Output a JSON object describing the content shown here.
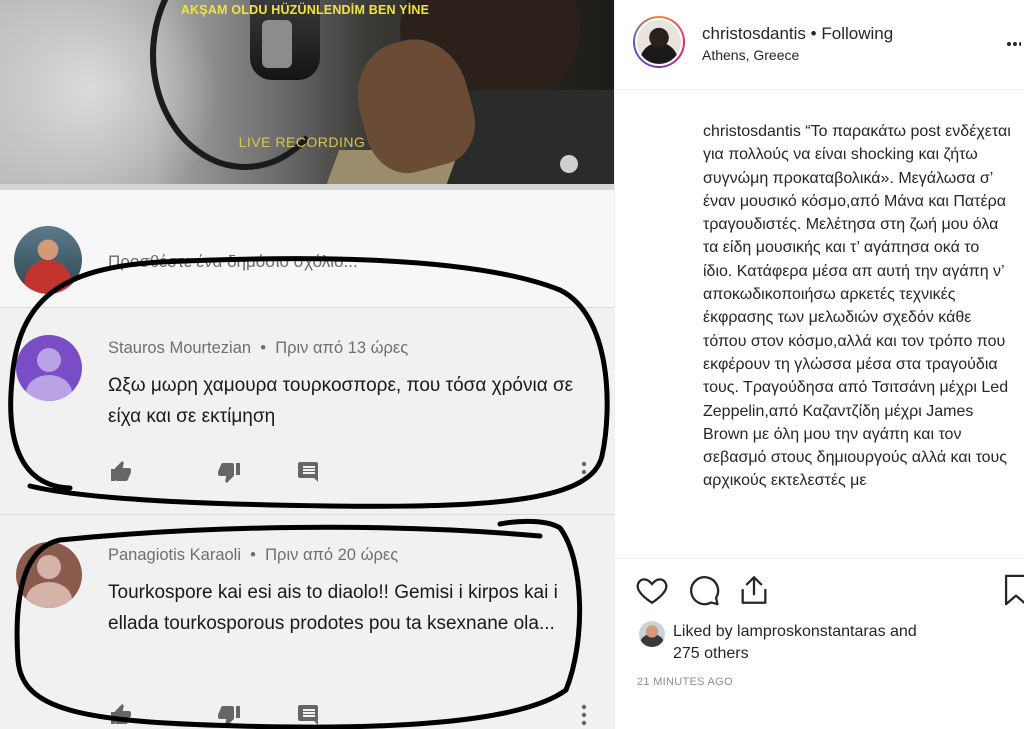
{
  "video": {
    "title": "AKŞAM OLDU HÜZÜNLENDİM BEN YİNE",
    "overlay": "LIVE RECORDING"
  },
  "add_comment": {
    "placeholder": "Προσθέστε ένα δημόσιο σχόλιο..."
  },
  "comments": [
    {
      "author": "Stauros Mourtezian",
      "time": "Πριν από 13 ώρες",
      "text": "Ωξω μωρη χαμουρα τουρκοσπορε, που τόσα χρόνια σε είχα και σε εκτίμηση",
      "avatar_color": "#7a4cc6"
    },
    {
      "author": "Panagiotis Karaoli",
      "time": "Πριν από 20 ώρες",
      "text": "Tourkospore kai esi ais to diaolo!! Gemisi i kirpos kai i ellada tourkosporous prodotes pou ta ksexnane ola...",
      "avatar_color": "#8a5a4c"
    }
  ],
  "instagram": {
    "username": "christosdantis",
    "follow_state": "Following",
    "location": "Athens, Greece",
    "caption": "“Το παρακάτω post ενδέχεται για πολλούς να είναι shocking και ζήτω συγνώμη προκαταβολικά». Μεγάλωσα σ’ έναν μουσικό κόσμο,από Μάνα και Πατέρα τραγουδιστές. Μελέτησα στη ζωή μου όλα τα είδη μουσικής και τ’ αγάπησα οκά το ίδιο. Κατάφερα μέσα απ αυτή την αγάπη ν’ αποκωδικοποιήσω αρκετές τεχνικές έκφρασης των μελωδιών σχεδόν κάθε τόπου στον κόσμο,αλλά και τον τρόπο που εκφέρουν τη γλώσσα μέσα στα τραγούδια τους. Τραγούδησα από Τσιτσάνη μέχρι Led Zeppelin,από Καζαντζίδη μέχρι James Brown με όλη μου την αγάπη και τον σεβασμό στους δημιουργούς αλλά και τους αρχικούς εκτελεστές με",
    "liked_by_prefix": "Liked by",
    "liked_by_user": "lamproskonstantaras",
    "liked_by_suffix": "and",
    "others": "275 others",
    "time_ago": "21 MINUTES AGO"
  },
  "icons": [
    "thumbs-up-icon",
    "thumbs-down-icon",
    "reply-icon",
    "more-vertical-icon",
    "heart-icon",
    "comment-icon",
    "share-icon",
    "bookmark-icon",
    "more-horizontal-icon"
  ],
  "colors": {
    "youtube_bg": "#f1f1f1",
    "scribble": "#000000",
    "video_title": "#f2e53a",
    "instagram_text": "#262626"
  }
}
